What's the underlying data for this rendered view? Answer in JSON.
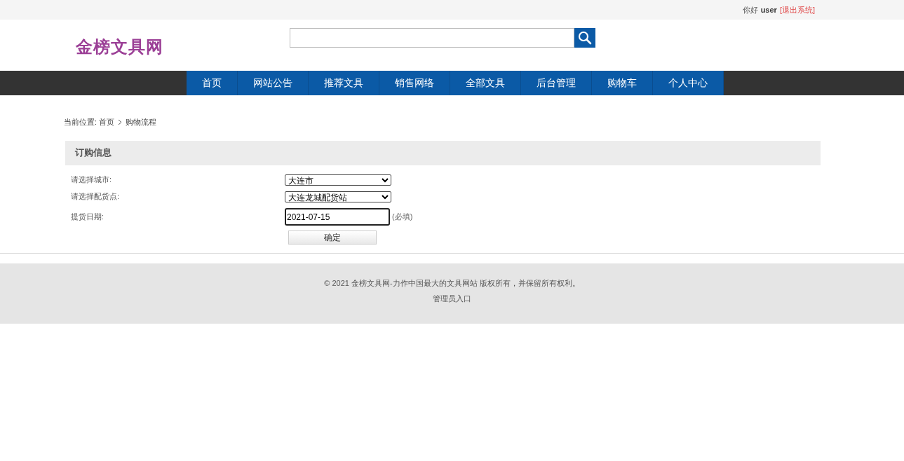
{
  "top_bar": {
    "greeting": "你好",
    "username": "user",
    "logout_link": "[退出系统]"
  },
  "header": {
    "logo": "金榜文具网"
  },
  "nav": [
    {
      "label": "首页",
      "selected": false
    },
    {
      "label": "网站公告",
      "selected": false
    },
    {
      "label": "推荐文具",
      "selected": false
    },
    {
      "label": "销售网络",
      "selected": false
    },
    {
      "label": "全部文具",
      "selected": false
    },
    {
      "label": "后台管理",
      "selected": false
    },
    {
      "label": "购物车",
      "selected": false
    },
    {
      "label": "个人中心",
      "selected": false
    }
  ],
  "breadcrumb": {
    "prefix": "当前位置:",
    "items": [
      "首页",
      "购物流程"
    ]
  },
  "order_panel": {
    "title": "订购信息",
    "fields": [
      {
        "kind": "select",
        "label": "请选择城市:",
        "value": "大连市"
      },
      {
        "kind": "select",
        "label": "请选择配货点:",
        "value": "大连龙城配货站"
      },
      {
        "kind": "date",
        "label": "提货日期:",
        "value": "2021-07-15",
        "note": "(必填)"
      }
    ],
    "submit": "确定"
  },
  "footer": {
    "copyright": "© 2021 金榜文具网-力作中国最大的文具网站 版权所有，并保留所有权利。",
    "admin_link": "管理员入口"
  }
}
